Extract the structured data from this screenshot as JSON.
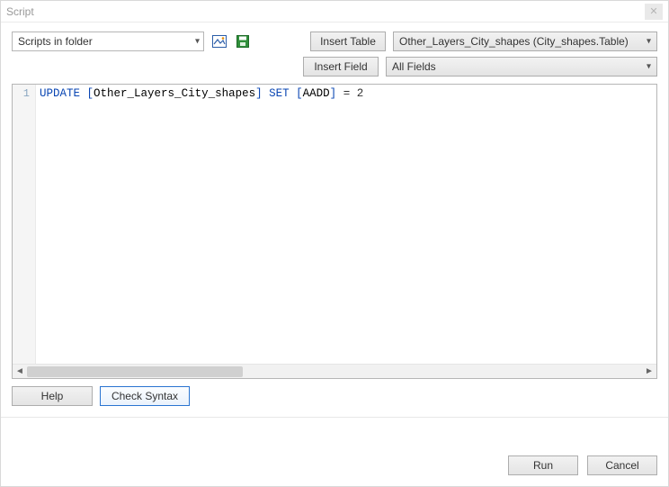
{
  "window": {
    "title": "Script"
  },
  "top": {
    "folder_label": "Scripts in folder",
    "insert_table_label": "Insert Table",
    "insert_field_label": "Insert Field",
    "table_combo": "Other_Layers_City_shapes   (City_shapes.Table)",
    "fields_combo": "All Fields"
  },
  "code": {
    "line_no": "1",
    "kw_update": "UPDATE",
    "bracket_open1": "[",
    "ident1": "Other_Layers_City_shapes",
    "bracket_close1": "]",
    "kw_set": "SET",
    "bracket_open2": "[",
    "ident2": "AADD",
    "bracket_close2": "]",
    "eq": " = ",
    "val": "2"
  },
  "buttons": {
    "help": "Help",
    "check_syntax": "Check Syntax",
    "run": "Run",
    "cancel": "Cancel"
  },
  "icons": {
    "image_icon": "🖼",
    "save_icon": "💾"
  }
}
